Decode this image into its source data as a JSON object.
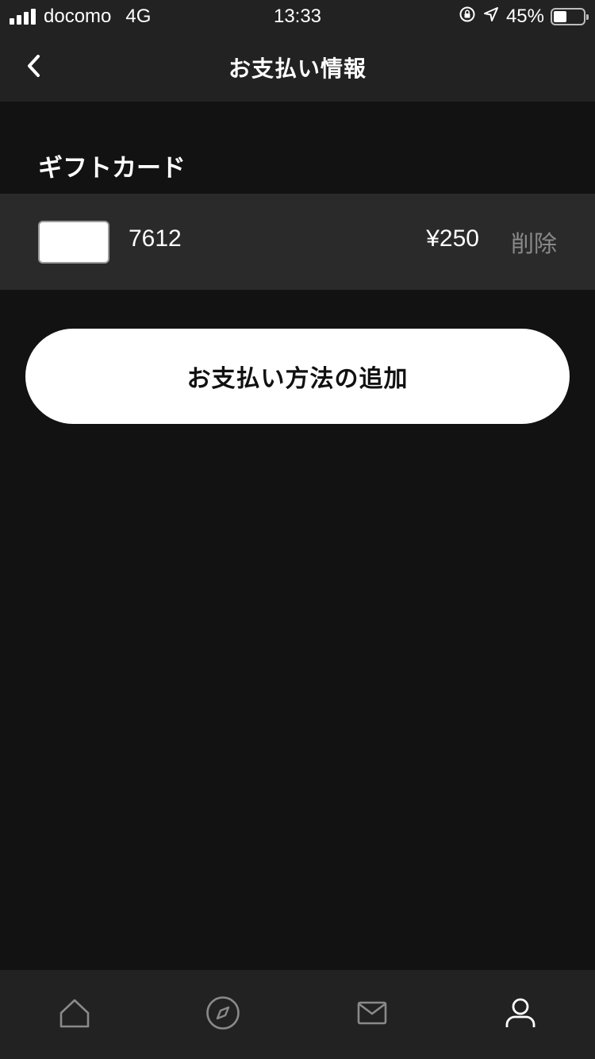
{
  "status_bar": {
    "carrier": "docomo",
    "network": "4G",
    "time": "13:33",
    "battery": "45%",
    "battery_level": 0.45
  },
  "nav": {
    "title": "お支払い情報",
    "back_icon": "chevron-left-icon"
  },
  "gift_card_section": {
    "header": "ギフトカード",
    "cards": [
      {
        "number": "7612",
        "balance": "¥250",
        "delete_label": "削除"
      }
    ]
  },
  "add_payment_button": {
    "label": "お支払い方法の追加"
  },
  "tab_bar": {
    "tabs": [
      {
        "icon": "home-icon",
        "active": false
      },
      {
        "icon": "compass-icon",
        "active": false
      },
      {
        "icon": "mail-icon",
        "active": false
      },
      {
        "icon": "profile-icon",
        "active": true
      }
    ]
  },
  "colors": {
    "background": "#121212",
    "bar": "#222222",
    "row": "#2a2a2a",
    "muted_text": "#8a8a8a",
    "inactive_icon": "#8a8a8a",
    "active_icon": "#ffffff"
  }
}
